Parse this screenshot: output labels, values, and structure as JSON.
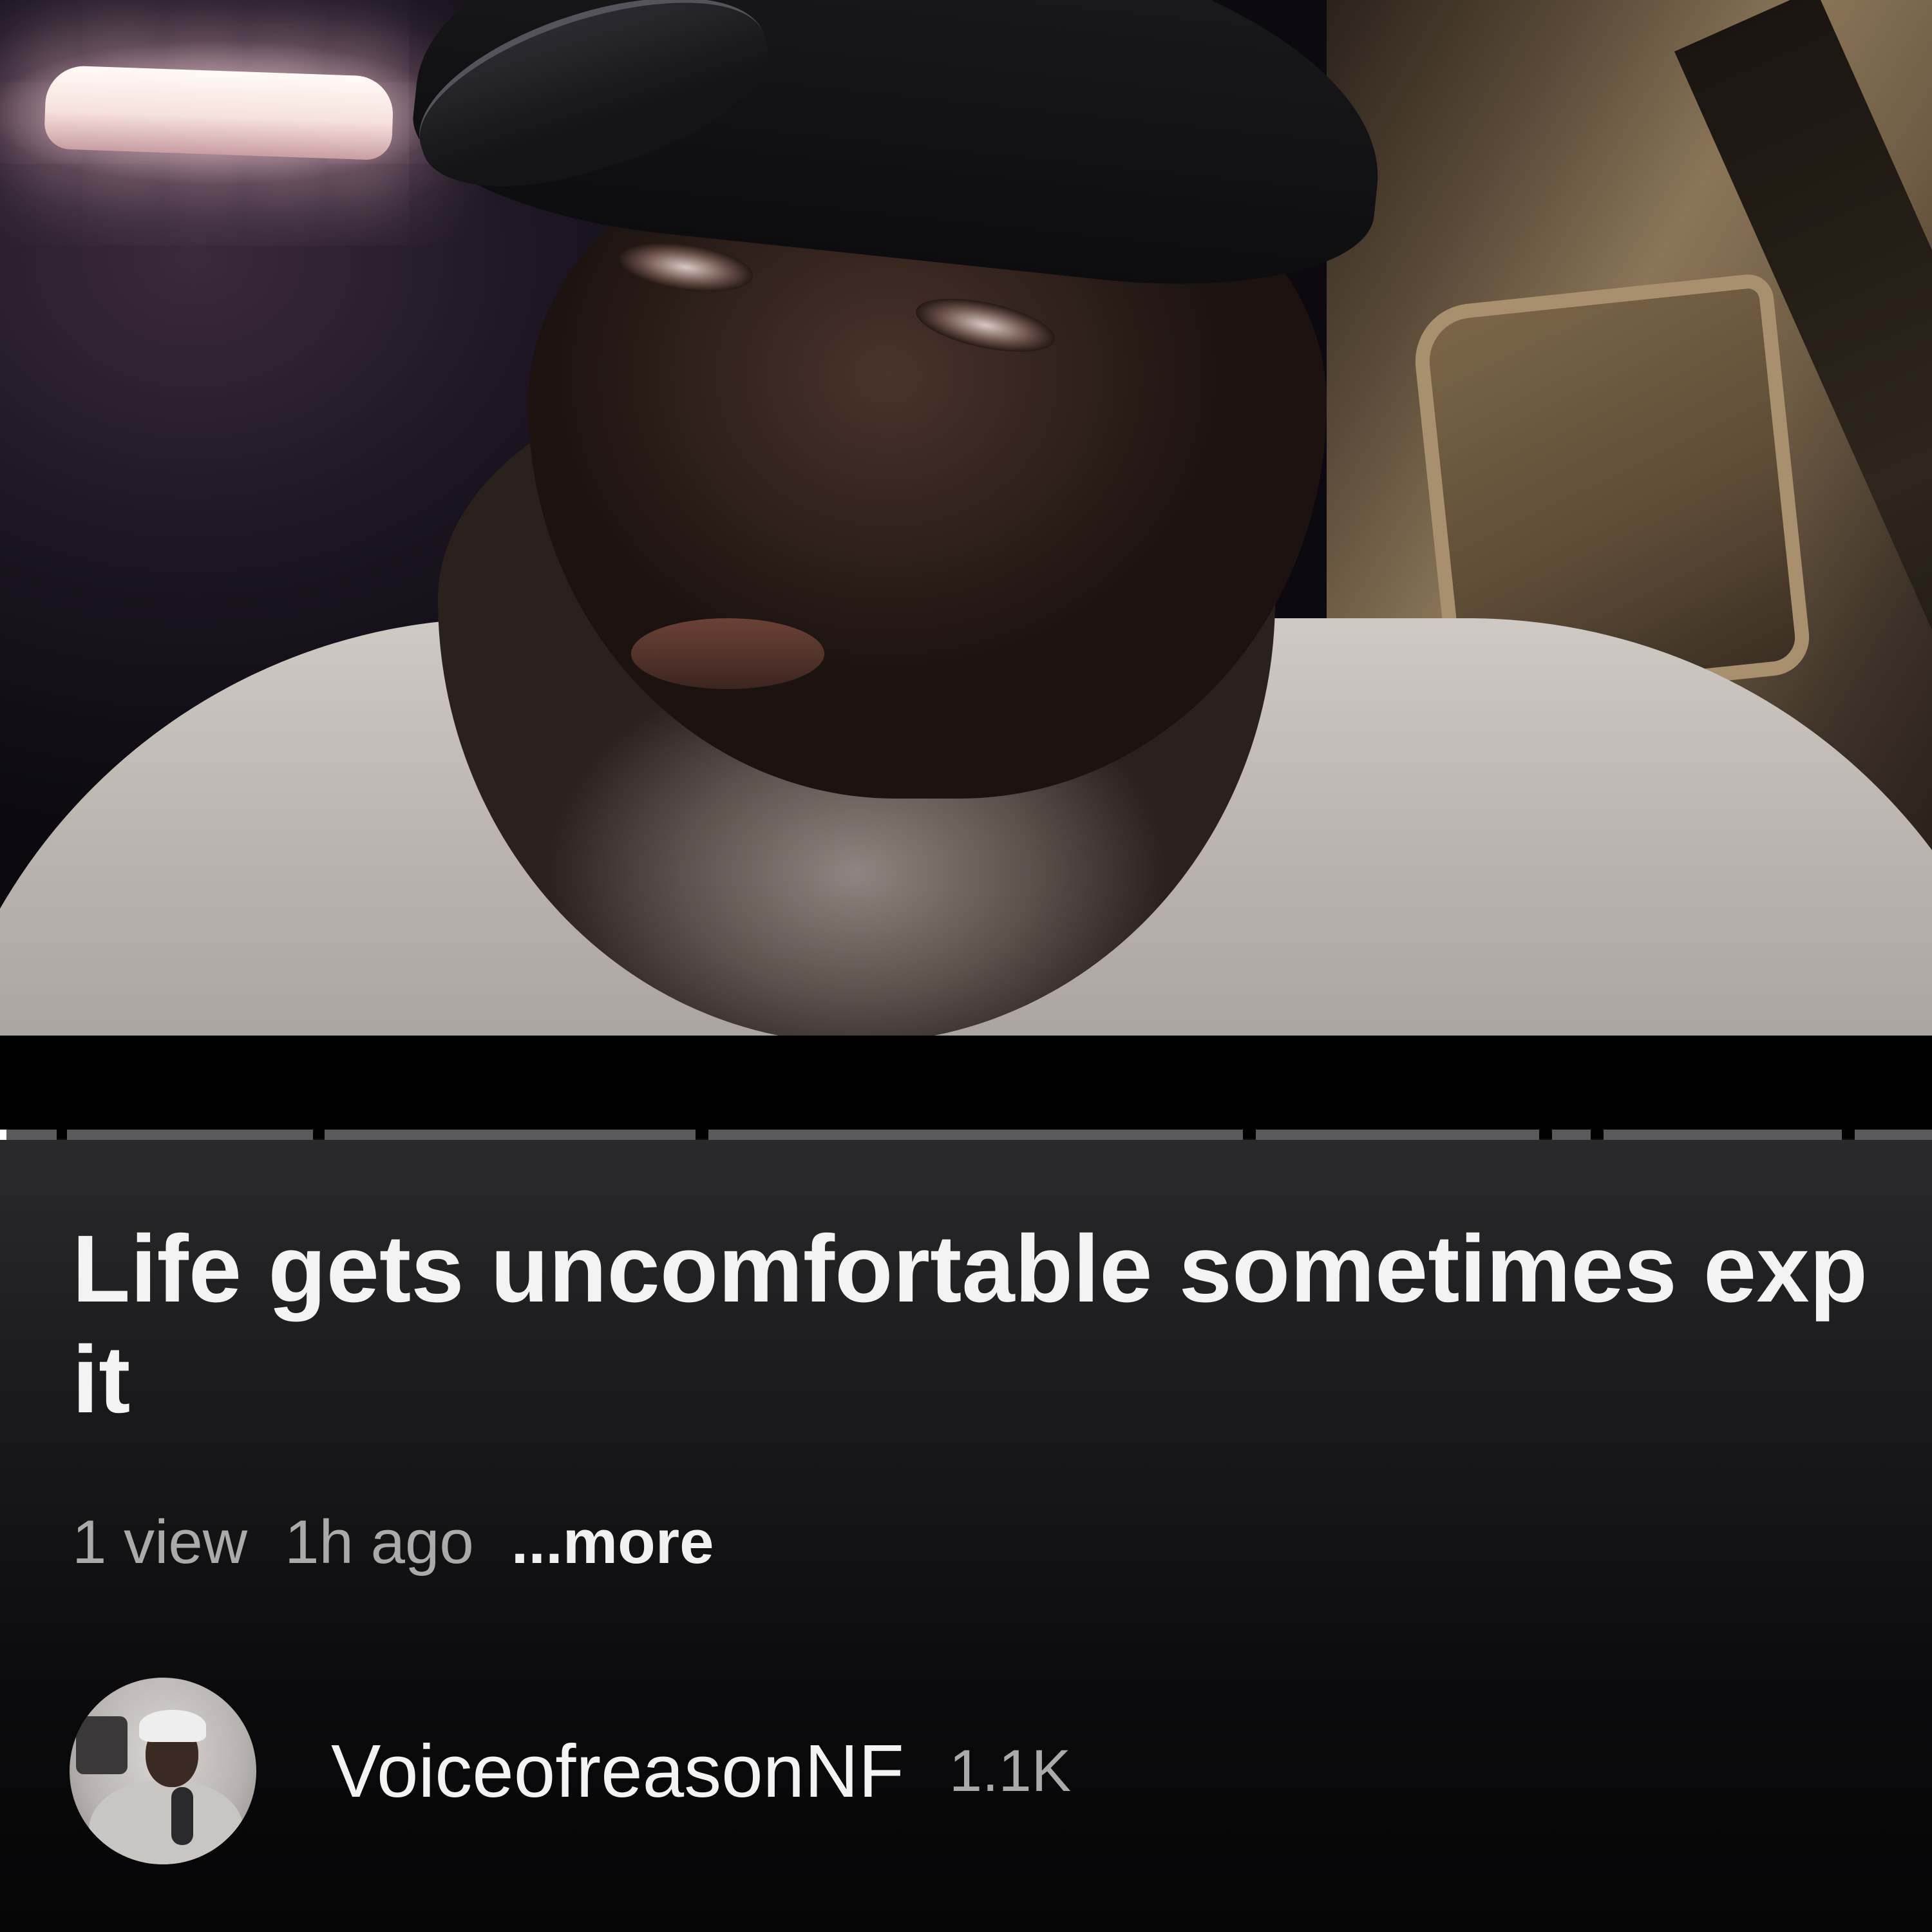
{
  "video": {
    "title": "Life gets uncomfortable sometimes exp\nit",
    "views": "1 view",
    "age": "1h ago",
    "more_label": "...more",
    "progress_fraction": 0.003
  },
  "channel": {
    "name": "VoiceofreasonNF",
    "subscribers": "1.1K"
  },
  "icons": {
    "avatar": "channel-avatar"
  },
  "colors": {
    "background": "#0f0e10",
    "progress_played": "#ffffff",
    "progress_track": "#5b5a5d",
    "secondary_text": "#aaaaaa"
  }
}
